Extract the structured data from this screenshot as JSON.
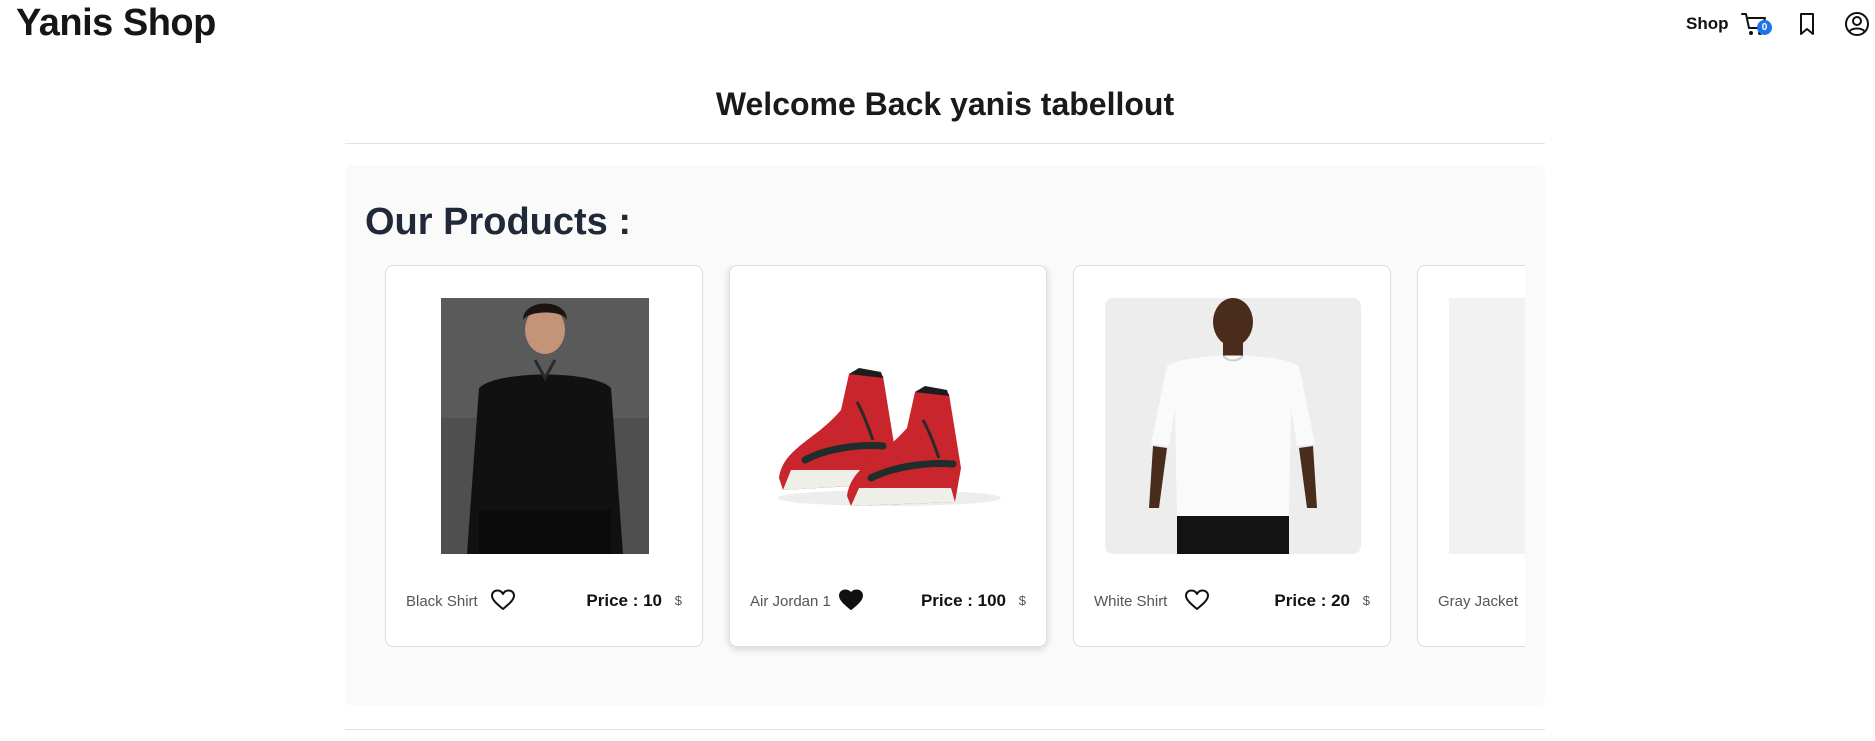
{
  "header": {
    "brand": "Yanis Shop",
    "nav_shop": "Shop",
    "cart_count": "0",
    "icons": {
      "cart": "cart-icon",
      "bookmark": "bookmark-icon",
      "user": "user-icon"
    }
  },
  "welcome": "Welcome Back yanis tabellout",
  "section_title": "Our Products :",
  "products": [
    {
      "name": "Black Shirt",
      "price_label": "Price : 10",
      "currency": "$",
      "favorited": false,
      "image": "black-shirt-photo"
    },
    {
      "name": "Air Jordan 1",
      "price_label": "Price : 100",
      "currency": "$",
      "favorited": true,
      "image": "air-jordan-photo"
    },
    {
      "name": "White Shirt",
      "price_label": "Price : 20",
      "currency": "$",
      "favorited": false,
      "image": "white-shirt-photo"
    },
    {
      "name": "Gray Jacket",
      "favorited": false,
      "image": "gray-jacket-photo"
    }
  ],
  "colors": {
    "accent": "#1e73e8",
    "text": "#1b1b1b",
    "section_bg": "#fafafa"
  }
}
